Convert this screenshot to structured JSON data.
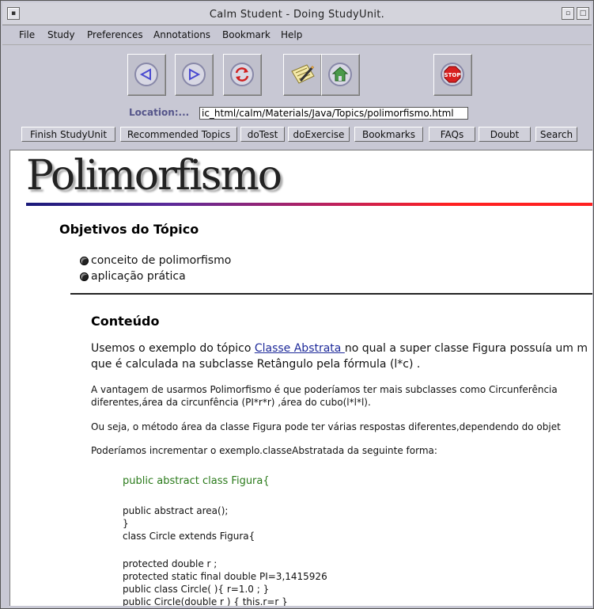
{
  "window": {
    "title": "Calm Student - Doing StudyUnit."
  },
  "menu": {
    "items": [
      "File",
      "Study",
      "Preferences",
      "Annotations",
      "Bookmark",
      "Help"
    ]
  },
  "toolbar": {
    "location_label": "Location:...",
    "location_value": "ic_html/calm/Materials/Java/Topics/polimorfismo.html"
  },
  "nav_buttons": [
    "Finish StudyUnit",
    "Recommended Topics",
    "doTest",
    "doExercise",
    "Bookmarks",
    "FAQs",
    "Doubt",
    "Search"
  ],
  "page": {
    "heading": "Polimorfismo",
    "objectives_title": "Objetivos do Tópico",
    "objectives": [
      "conceito de polimorfismo",
      "aplicação prática"
    ],
    "content_title": "Conteúdo",
    "para1_before": "Usemos o exemplo do tópico ",
    "para1_link": "Classe Abstrata ",
    "para1_after": "no qual a super classe Figura possuía um m",
    "para1_line2": "que é calculada na subclasse Retângulo pela fórmula (l*c) .",
    "para2_line1": "A vantagem de usarmos Polimorfismo é que poderíamos ter mais subclasses como Circunferência",
    "para2_line2": "diferentes,área da circunfência (PI*r*r) ,área do cubo(l*l*l).",
    "para3": "Ou seja, o método área da classe Figura pode ter várias respostas diferentes,dependendo do objet",
    "para4": "Poderíamos incrementar o exemplo.classeAbstratada da seguinte forma:",
    "code_green": "public abstract class Figura{",
    "code_lines": [
      "public abstract area();",
      "}",
      "class Circle extends Figura{",
      "",
      "protected double r ;",
      "protected static final double PI=3,1415926",
      "public class Circle( ){ r=1.0 ; }",
      "public Circle(double r ) { this.r=r }"
    ]
  }
}
